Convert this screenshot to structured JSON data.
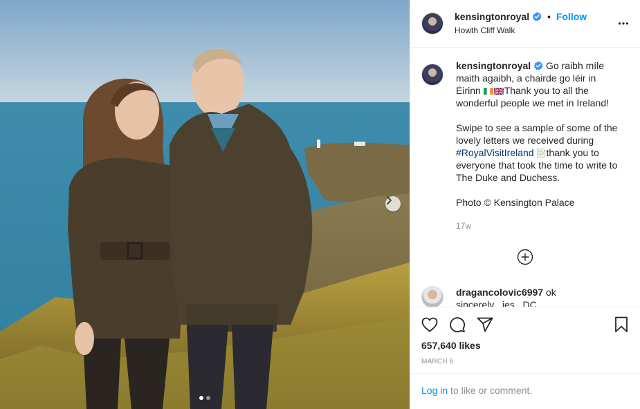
{
  "post": {
    "username": "kensingtonroyal",
    "follow_label": "Follow",
    "bullet": "•",
    "location": "Howth Cliff Walk",
    "caption_part1": "Go raibh míle maith agaibh, a chairde go léir in Éirinn ",
    "caption_part2": "Thank you to all the wonderful people we met in Ireland!\n\nSwipe to see a sample of some of the lovely letters we received during ",
    "hashtag": "#RoyalVisitIreland",
    "caption_part3": "thank you to everyone that took the time to write to The Duke and Duchess.\n\nPhoto © Kensington Palace",
    "time_ago": "17w",
    "likes": "657,640 likes",
    "date": "MARCH 6"
  },
  "comment": {
    "username": "dragancolovic6997",
    "text": " ok",
    "text_cut": "sincerely , jes , DC"
  },
  "footer": {
    "login_link": "Log in",
    "login_rest": " to like or comment."
  },
  "carousel": {
    "current": 1,
    "total": 2
  },
  "icons": {
    "verified": "verified-badge-icon",
    "more": "more-options-icon",
    "heart": "heart-icon",
    "comment": "comment-bubble-icon",
    "share": "share-paper-plane-icon",
    "save": "bookmark-icon",
    "load_more": "plus-circle-icon",
    "next": "chevron-right-icon"
  },
  "colors": {
    "accent": "#0095f6",
    "verified": "#3897f0",
    "hashtag": "#00376b",
    "muted": "#8e8e8e"
  }
}
